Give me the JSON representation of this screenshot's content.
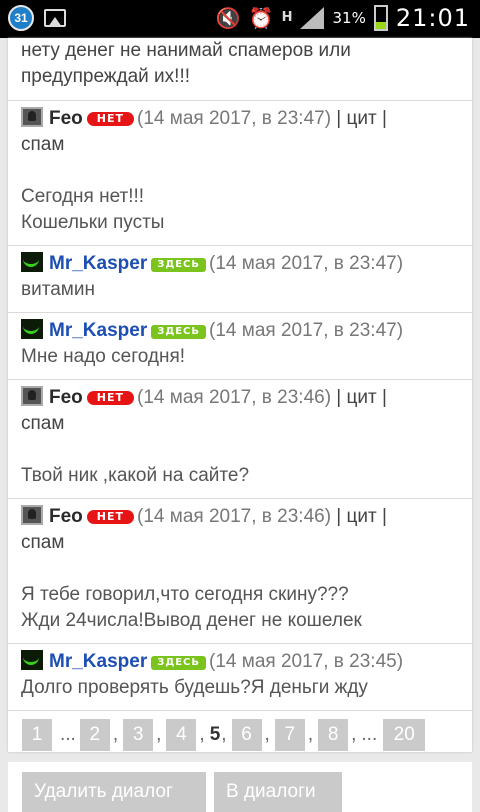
{
  "status_bar": {
    "calendar_badge": "31",
    "hspa": "H",
    "battery_percent": "31%",
    "battery_level": 0.31,
    "clock": "21:01"
  },
  "top_fragment": {
    "lines": [
      "нету денег не нанимай спамеров или",
      "предупреждай их!!!"
    ]
  },
  "messages": [
    {
      "user": "Feo",
      "badge": "НЕТ",
      "time": "(14 мая 2017, в 23:47)",
      "links": [
        " | цит |",
        "спам"
      ],
      "body": [
        "Сегодня нет!!!",
        "Кошельки пусты"
      ]
    },
    {
      "user": "Mr_Kasper",
      "badge": "ЗДЕСЬ",
      "time": "(14 мая 2017, в 23:47)",
      "body": [
        "витамин"
      ]
    },
    {
      "user": "Mr_Kasper",
      "badge": "ЗДЕСЬ",
      "time": "(14 мая 2017, в 23:47)",
      "body": [
        "Мне надо сегодня!"
      ]
    },
    {
      "user": "Feo",
      "badge": "НЕТ",
      "time": "(14 мая 2017, в 23:46)",
      "links": [
        " | цит |",
        "спам"
      ],
      "body": [
        "Твой ник ,какой на сайте?"
      ]
    },
    {
      "user": "Feo",
      "badge": "НЕТ",
      "time": "(14 мая 2017, в 23:46)",
      "links": [
        " | цит |",
        "спам"
      ],
      "body": [
        "Я тебе говорил,что сегодня скину???",
        "Жди 24числа!Вывод денег не кошелек"
      ]
    },
    {
      "user": "Mr_Kasper",
      "badge": "ЗДЕСЬ",
      "time": "(14 мая 2017, в 23:45)",
      "body": [
        "Долго проверять будешь?Я деньги жду"
      ]
    }
  ],
  "pagination": {
    "first": "1",
    "dots": "...",
    "pages_before": [
      "2",
      "3",
      "4"
    ],
    "current": "5",
    "pages_after": [
      "6",
      "7",
      "8"
    ],
    "last": "20",
    "comma": ","
  },
  "actions": {
    "delete_dialog": "Удалить диалог",
    "to_dialogs": "В диалоги"
  },
  "colors": {
    "offline_badge": "#e61414",
    "online_badge": "#7ac41d",
    "kasper_name": "#1d4fb3"
  }
}
